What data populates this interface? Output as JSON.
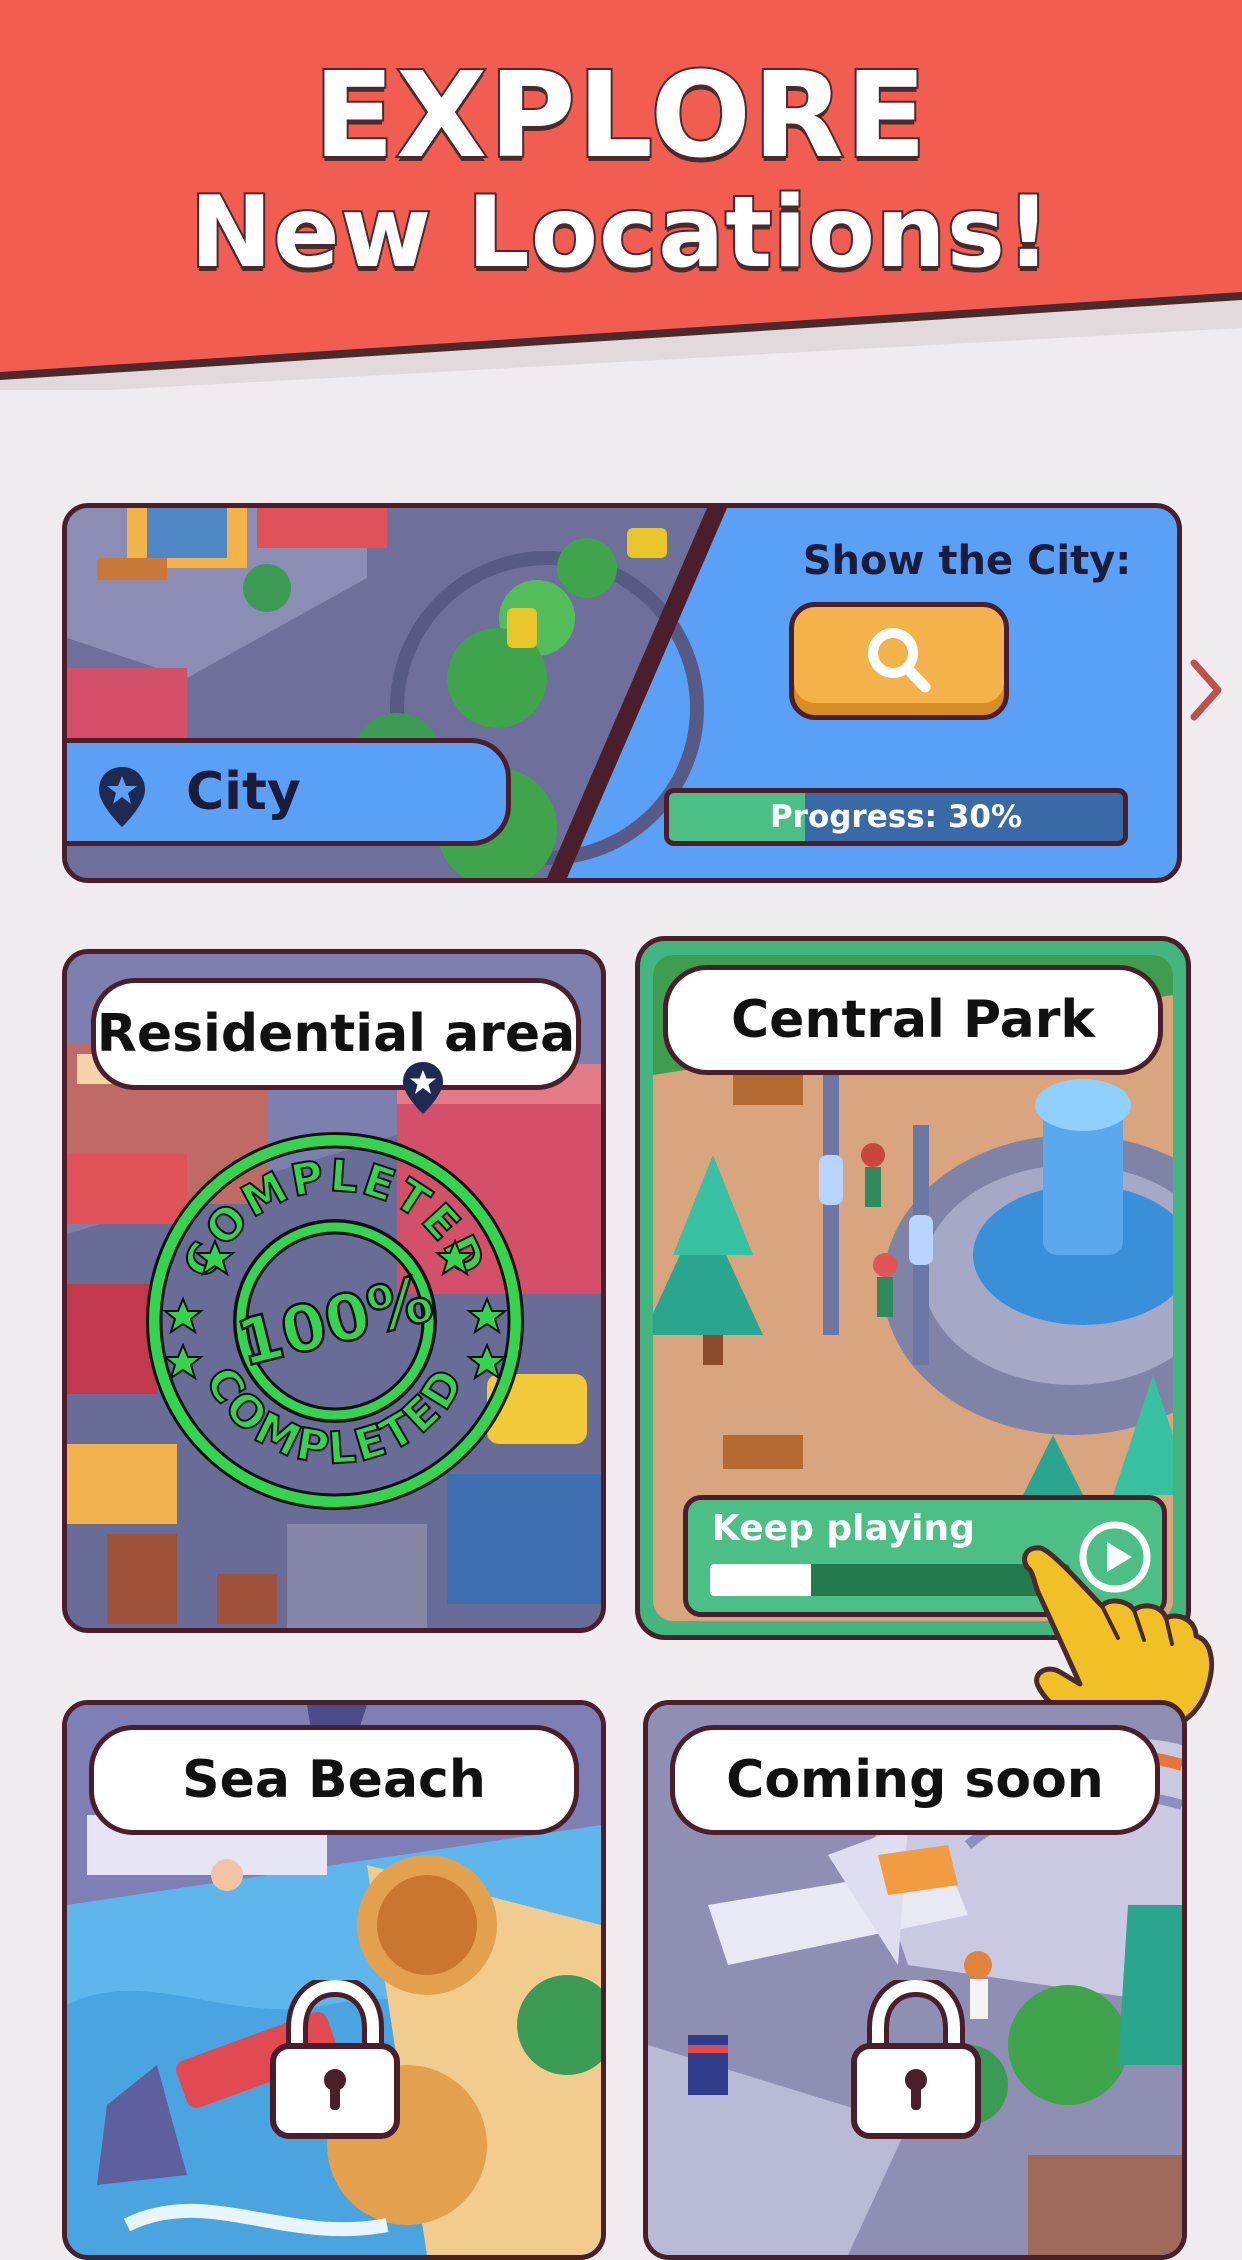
{
  "header": {
    "headline_line1": "EXPLORE",
    "headline_line2": "New Locations!"
  },
  "city_card": {
    "show_label": "Show the City:",
    "name": "City",
    "progress_text": "Progress: 30%",
    "progress_fraction": 0.3
  },
  "locations": {
    "residential": {
      "name": "Residential area",
      "stamp_top": "COMPLETED",
      "stamp_percent": "100%",
      "stamp_bottom": "COMPLETED"
    },
    "park": {
      "name": "Central Park",
      "button_label": "Keep playing",
      "progress_fraction": 0.28
    },
    "beach": {
      "name": "Sea Beach"
    },
    "soon": {
      "name": "Coming soon"
    }
  },
  "colors": {
    "banner": "#f25d52",
    "outline": "#4a1f2b",
    "city_blue": "#5aa0f7",
    "accent_green": "#4cbf86",
    "button_orange": "#f3b24a",
    "stamp_green": "#35d44e",
    "hand_yellow": "#f1bf26"
  },
  "icons": {
    "search": "search-icon",
    "pin": "map-pin-star-icon",
    "next": "chevron-right-icon",
    "play": "play-icon",
    "lock": "padlock-icon",
    "hand": "pointing-hand-icon"
  }
}
